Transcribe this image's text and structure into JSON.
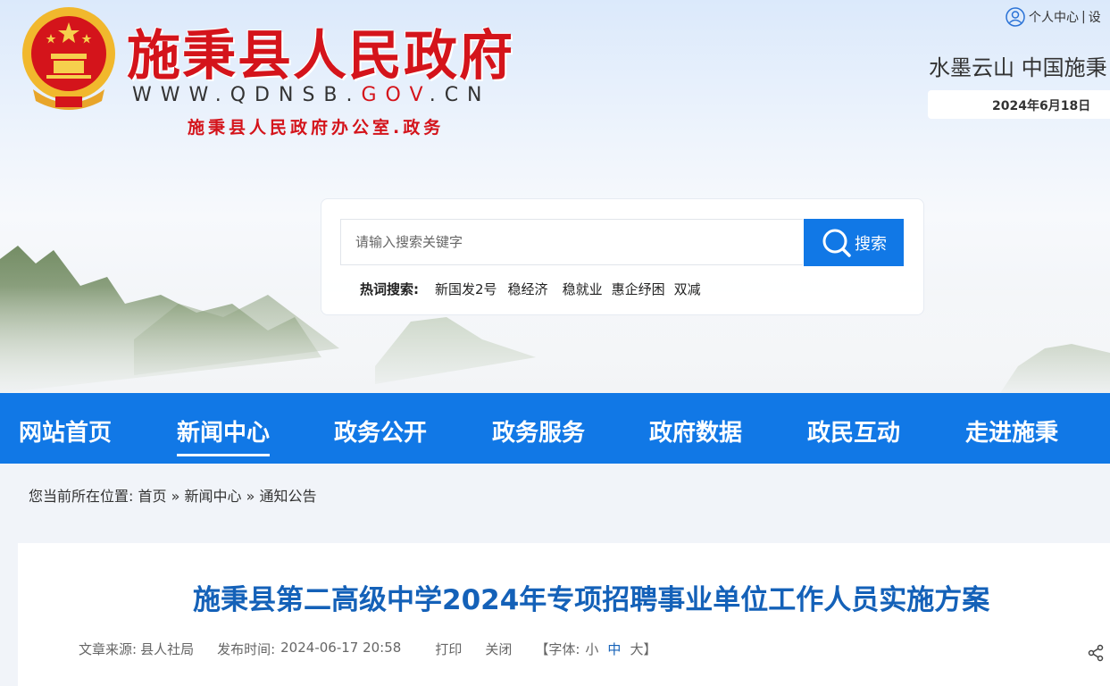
{
  "header": {
    "title": "施秉县人民政府",
    "url_prefix": "WWW.QDNSB.",
    "url_gov": "GOV",
    "url_suffix": ".CN",
    "office": "施秉县人民政府办公室.政务",
    "user_center": "个人中心",
    "divider": "|",
    "settings_partial": "设",
    "slogan": "水墨云山 中国施秉",
    "date": "2024年6月18日"
  },
  "search": {
    "placeholder": "请输入搜索关键字",
    "button_label": "搜索",
    "hot_label": "热词搜索:",
    "hot_words": [
      "新国发2号",
      "稳经济",
      "稳就业",
      "惠企纾困",
      "双减"
    ]
  },
  "nav": {
    "items": [
      "网站首页",
      "新闻中心",
      "政务公开",
      "政务服务",
      "政府数据",
      "政民互动",
      "走进施秉"
    ],
    "active_index": 1
  },
  "breadcrumb": {
    "prefix": "您当前所在位置:",
    "items": [
      "首页",
      "新闻中心",
      "通知公告"
    ],
    "separator": "»"
  },
  "article": {
    "title": "施秉县第二高级中学2024年专项招聘事业单位工作人员实施方案",
    "source_label": "文章来源:",
    "source": "县人社局",
    "date_label": "发布时间:",
    "date": "2024-06-17 20:58",
    "print": "打印",
    "close": "关闭",
    "font_label": "【字体:",
    "font_small": "小",
    "font_medium": "中",
    "font_large": "大",
    "font_end": "】"
  },
  "colors": {
    "brand_red": "#d4141b",
    "nav_blue": "#1178e6",
    "title_blue": "#1461b8"
  }
}
